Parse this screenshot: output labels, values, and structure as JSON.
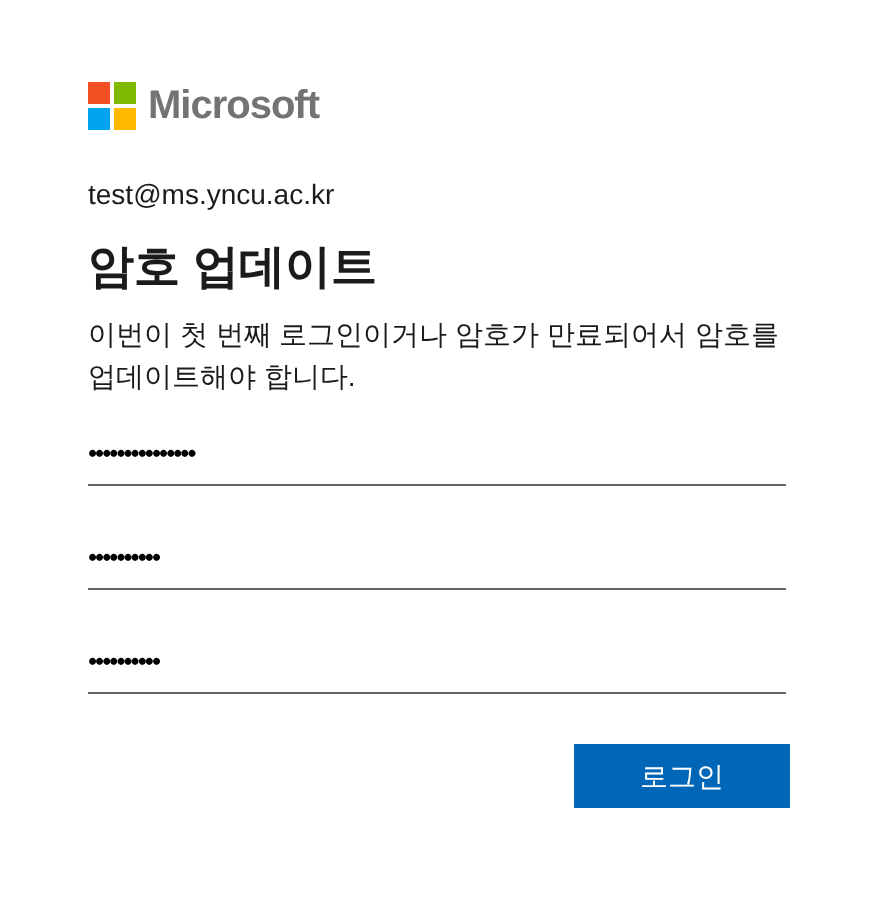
{
  "logo": {
    "text": "Microsoft"
  },
  "account": "test@ms.yncu.ac.kr",
  "title": "암호 업데이트",
  "description": "이번이 첫 번째 로그인이거나 암호가 만료되어서 암호를 업데이트해야 합니다.",
  "fields": [
    {
      "value": "•••••••••••••••"
    },
    {
      "value": "••••••••••"
    },
    {
      "value": "••••••••••"
    }
  ],
  "button": "로그인"
}
